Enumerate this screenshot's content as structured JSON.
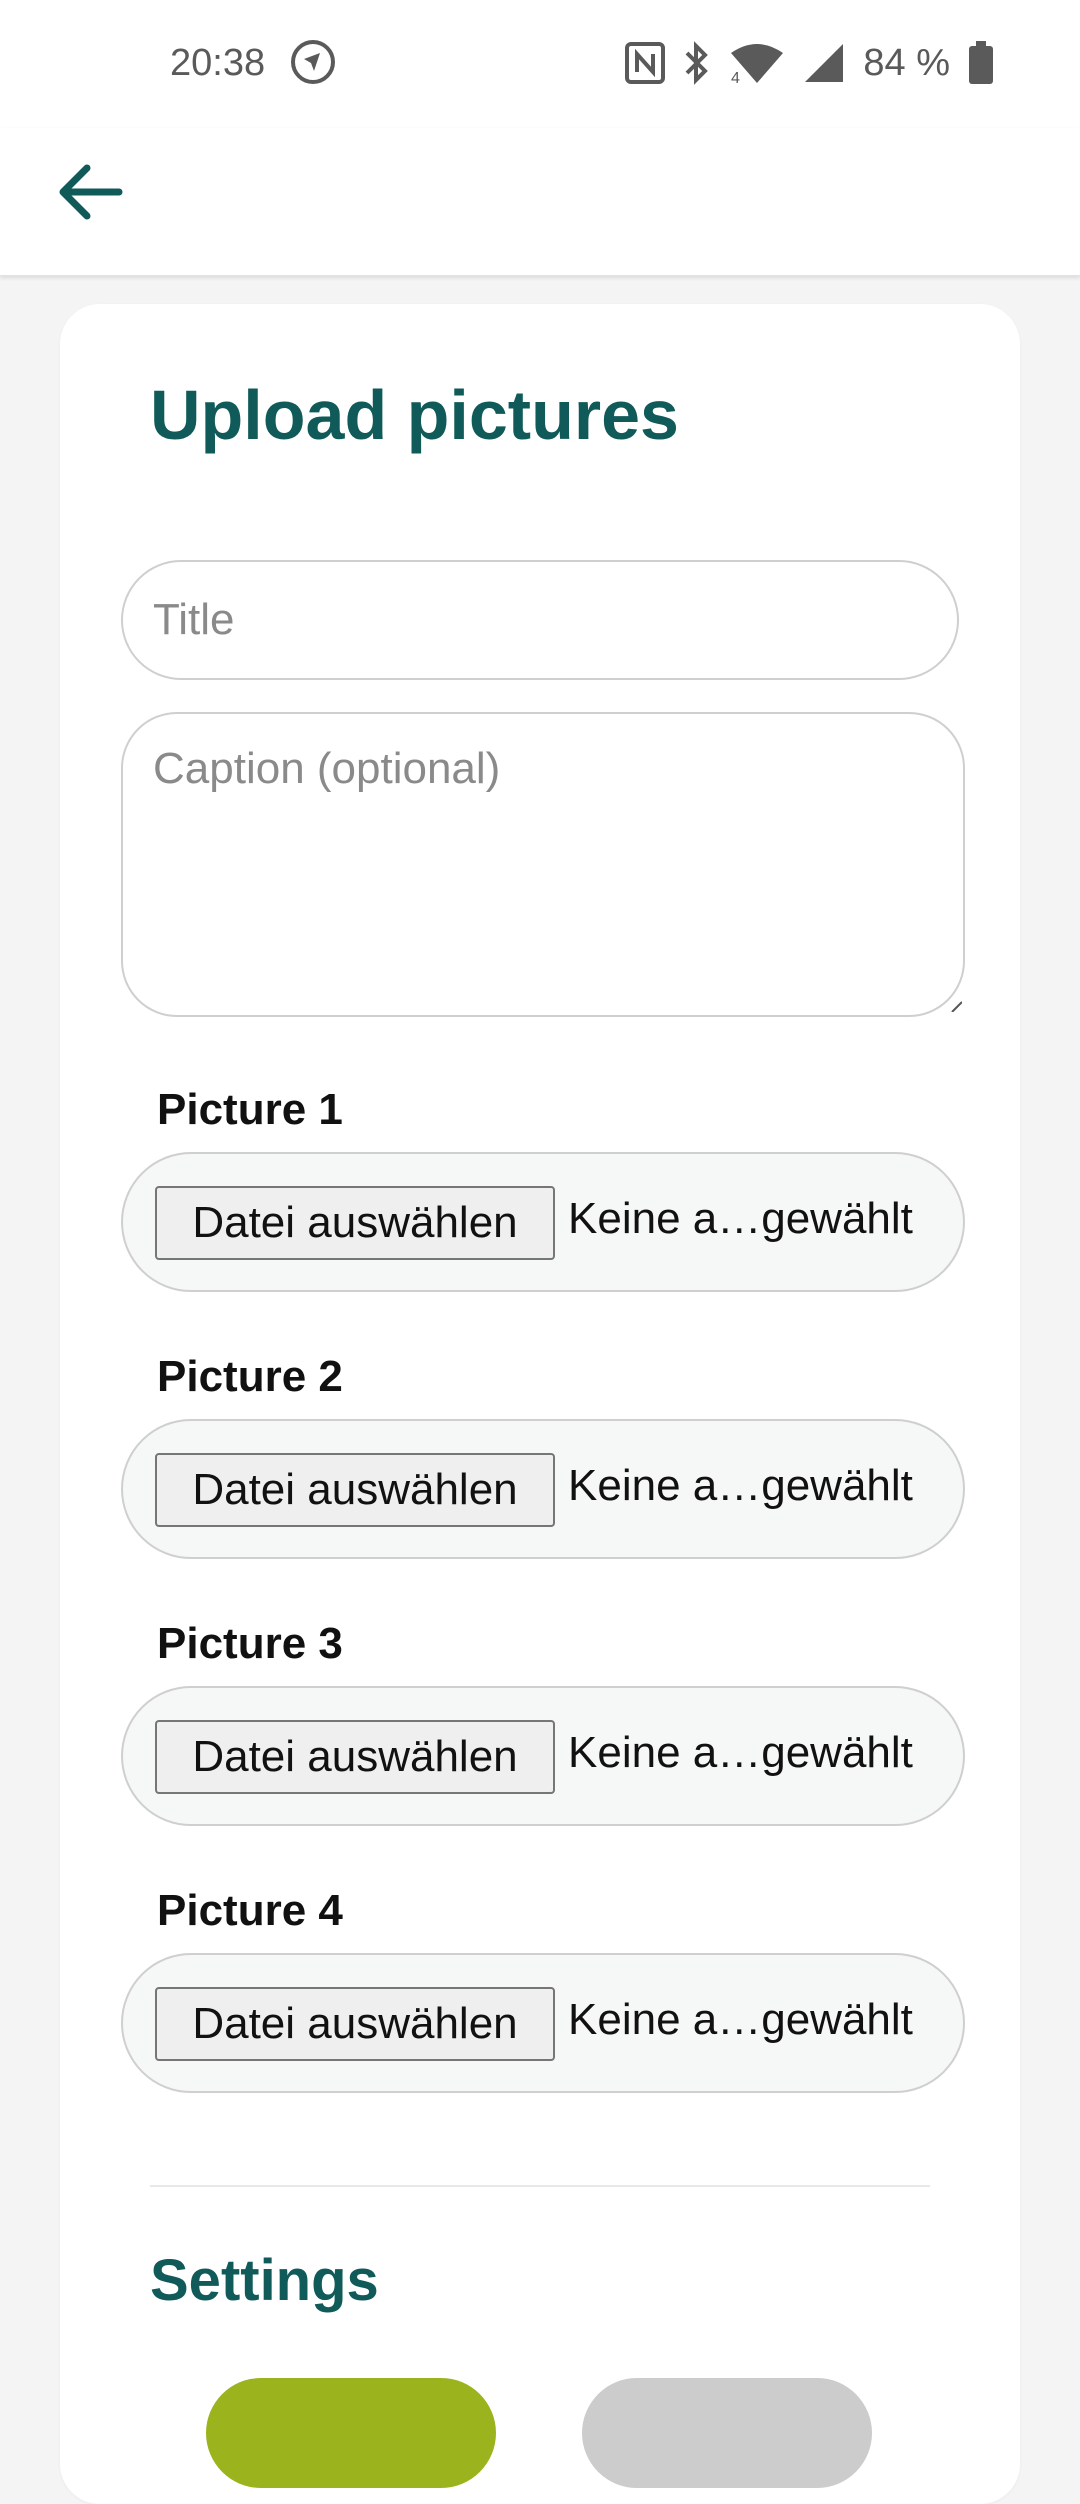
{
  "status_bar": {
    "time": "20:38",
    "battery": "84 %",
    "icons": [
      "news-app-icon",
      "nfc-icon",
      "bluetooth-icon",
      "wifi-icon",
      "signal-icon",
      "battery-icon"
    ]
  },
  "app_bar": {
    "back_icon": "arrow-left-icon"
  },
  "form": {
    "title": "Upload pictures",
    "title_placeholder": "Title",
    "caption_placeholder": "Caption (optional)",
    "pictures": [
      {
        "label": "Picture 1",
        "button": "Datei auswählen",
        "status": "Keine a…gewählt"
      },
      {
        "label": "Picture 2",
        "button": "Datei auswählen",
        "status": "Keine a…gewählt"
      },
      {
        "label": "Picture 3",
        "button": "Datei auswählen",
        "status": "Keine a…gewählt"
      },
      {
        "label": "Picture 4",
        "button": "Datei auswählen",
        "status": "Keine a…gewählt"
      }
    ]
  },
  "settings": {
    "title": "Settings"
  },
  "colors": {
    "brand": "#105a5a",
    "accent": "#9bb41e",
    "inactive": "#cccccc"
  }
}
